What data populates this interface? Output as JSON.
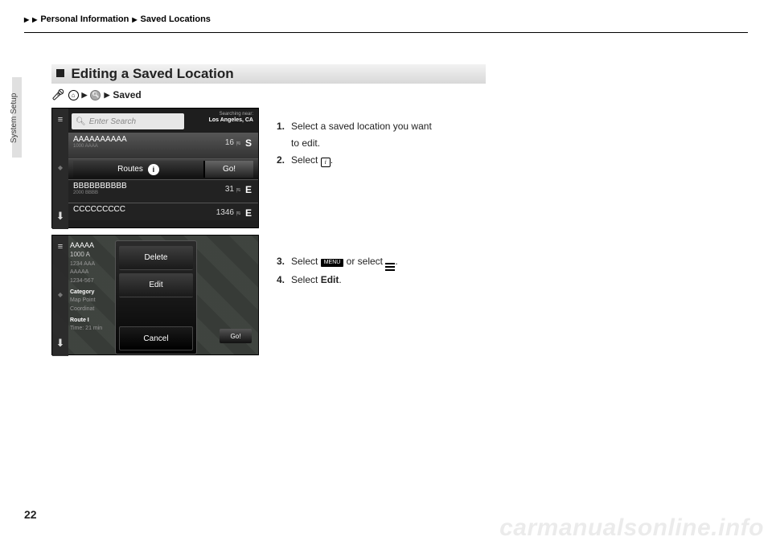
{
  "breadcrumb": {
    "seg1": "Personal Information",
    "seg2": "Saved Locations"
  },
  "side_tab": "System Setup",
  "heading": "Editing a Saved Location",
  "path": {
    "saved": "Saved"
  },
  "shot1": {
    "search_placeholder": "Enter Search",
    "near_label": "Searching near:",
    "near_value": "Los Angeles, CA",
    "rowA": {
      "name": "AAAAAAAAAA",
      "sub": "1000 AAAA",
      "dist": "16",
      "dir": "S"
    },
    "routes_label": "Routes",
    "go_label": "Go!",
    "rowB": {
      "name": "BBBBBBBBBB",
      "sub": "2000 BBBB",
      "dist": "31",
      "dir": "E"
    },
    "rowC": {
      "name": "CCCCCCCCC",
      "dist": "1346",
      "dir": "E"
    }
  },
  "shot2": {
    "title": "AAAAA",
    "addr1": "1000 A",
    "addr2": "1234 AAA",
    "addr3": "AAAAA",
    "phone": "1234-567",
    "cat_label": "Category",
    "cat_val": "Map Point",
    "coord_label": "Coordinat",
    "route_label": "Route I",
    "time_label": "Time: 21 min",
    "go": "Go!",
    "popup": {
      "delete": "Delete",
      "edit": "Edit",
      "cancel": "Cancel"
    }
  },
  "steps": {
    "s1a": "Select a saved location you want",
    "s1b": "to edit.",
    "s2a": "Select ",
    "s2b": ".",
    "s3a": "Select ",
    "s3b": " or select ",
    "s3c": ".",
    "s4a": "Select ",
    "s4b": "Edit",
    "s4c": "."
  },
  "menu_chip": "MENU",
  "page_number": "22",
  "watermark": "carmanualsonline.info"
}
